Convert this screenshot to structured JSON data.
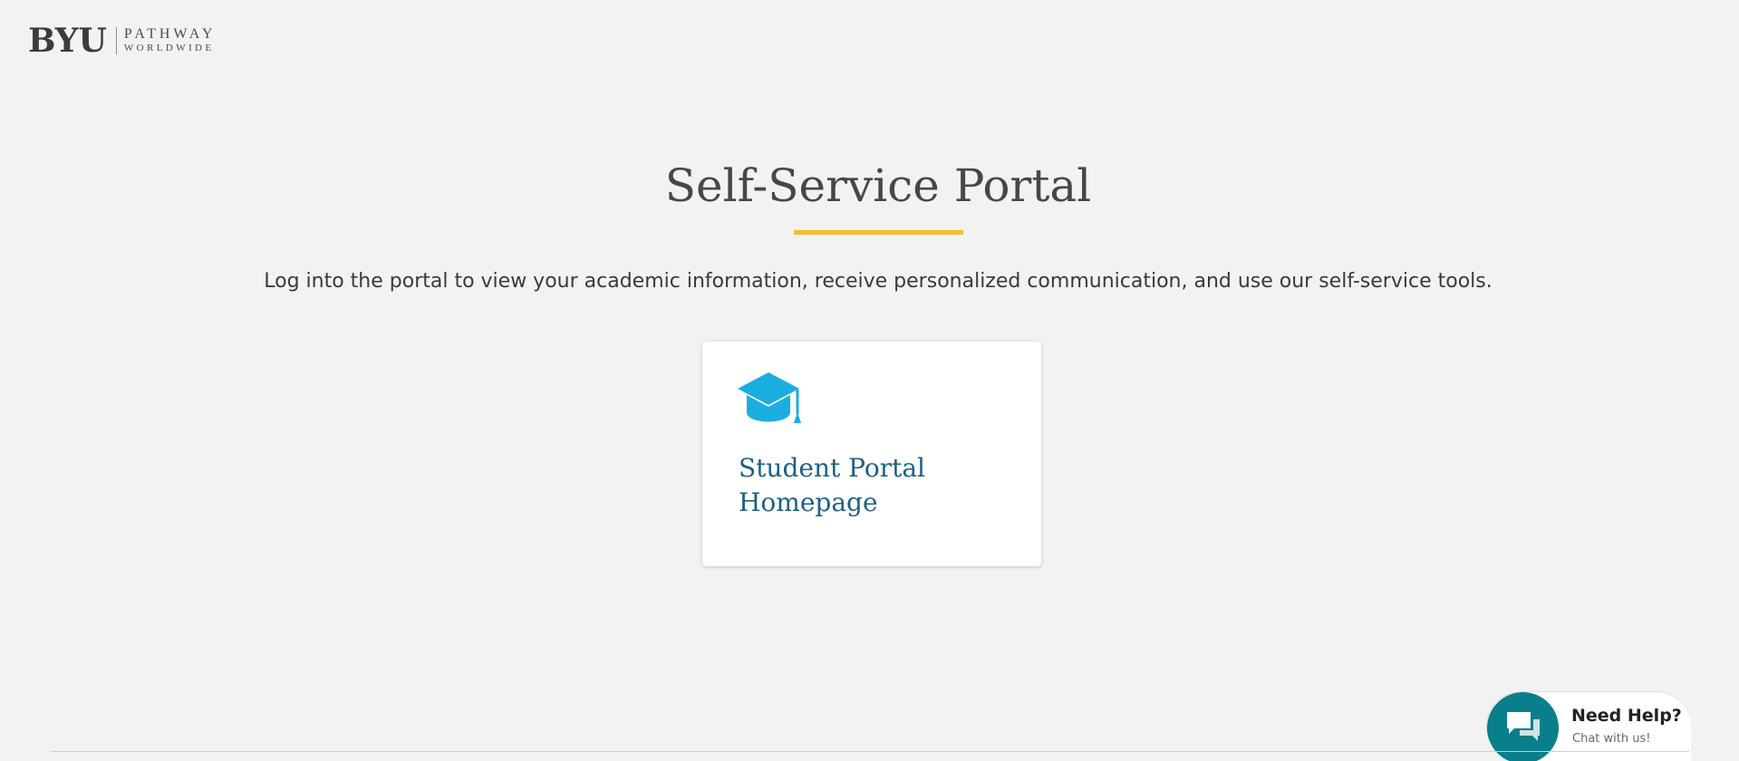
{
  "logo": {
    "byu": "BYU",
    "pathway": "PATHWAY",
    "worldwide": "WORLDWIDE"
  },
  "header": {
    "title": "Self-Service Portal",
    "intro": "Log into the portal to view your academic information, receive personalized communication, and use our self-service tools.",
    "accent_color": "#f5be2b"
  },
  "cards": [
    {
      "label": "Student Portal Homepage",
      "icon": "graduation-cap-icon",
      "icon_color": "#1aaee0"
    }
  ],
  "chat": {
    "title": "Need Help?",
    "subtitle": "Chat with us!",
    "icon": "chat-bubbles-icon",
    "color": "#087f8a"
  }
}
